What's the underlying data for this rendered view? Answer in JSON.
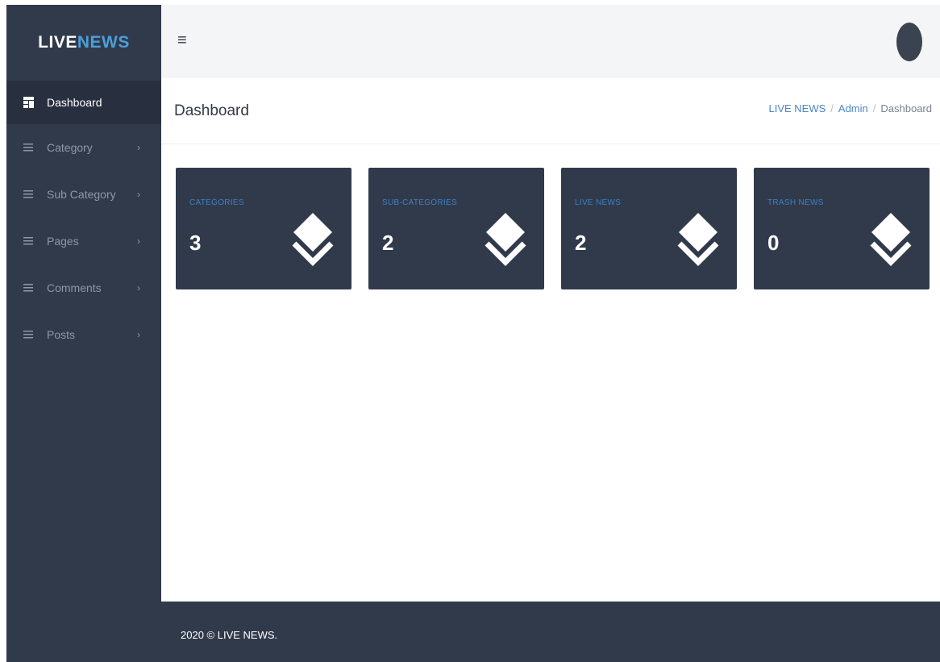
{
  "brand": {
    "part1": "LIVE",
    "part2": "NEWS"
  },
  "sidebar": {
    "items": [
      {
        "label": "Dashboard",
        "icon": "dashboard-icon",
        "active": true
      },
      {
        "label": "Category",
        "icon": "list-icon",
        "arrow": "›"
      },
      {
        "label": "Sub Category",
        "icon": "list-icon",
        "arrow": "›"
      },
      {
        "label": "Pages",
        "icon": "list-icon",
        "arrow": "›"
      },
      {
        "label": "Comments",
        "icon": "list-icon",
        "arrow": "›"
      },
      {
        "label": "Posts",
        "icon": "list-icon",
        "arrow": "›"
      }
    ]
  },
  "header": {
    "menu_icon": "≡"
  },
  "page": {
    "title": "Dashboard",
    "breadcrumb": [
      "LIVE NEWS",
      "Admin",
      "Dashboard"
    ],
    "breadcrumb_sep": "/"
  },
  "cards": [
    {
      "label": "CATEGORIES",
      "value": "3",
      "icon": "layers-icon"
    },
    {
      "label": "SUB-CATEGORIES",
      "value": "2",
      "icon": "layers-icon"
    },
    {
      "label": "LIVE NEWS",
      "value": "2",
      "icon": "layers-icon"
    },
    {
      "label": "TRASH NEWS",
      "value": "0",
      "icon": "layers-icon"
    }
  ],
  "footer": {
    "text": "2020 © LIVE NEWS."
  },
  "colors": {
    "sidebar_bg": "#313a4b",
    "accent_blue": "#4a9fd8",
    "card_bg": "#313a4b",
    "card_label": "#3e7fc2"
  }
}
